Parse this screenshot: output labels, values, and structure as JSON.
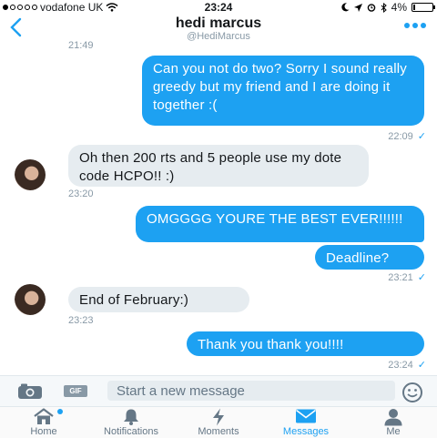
{
  "status": {
    "carrier": "vodafone UK",
    "time": "23:24",
    "battery": "4%"
  },
  "header": {
    "name": "hedi marcus",
    "handle": "@HediMarcus"
  },
  "conversation": {
    "prev_timestamp": "21:49",
    "messages": [
      {
        "dir": "out",
        "text": "Can you not do two? Sorry I sound really greedy but my friend and I are doing it together :("
      },
      {
        "dir": "meta",
        "time": "22:09",
        "check": "✓"
      },
      {
        "dir": "in",
        "text": "Oh then 200 rts and 5 people use my dote code HCPO!! :)"
      },
      {
        "dir": "meta",
        "time": "23:20"
      },
      {
        "dir": "out",
        "text": "OMGGGG YOURE THE BEST EVER!!!!!!"
      },
      {
        "dir": "out",
        "text": "Deadline?"
      },
      {
        "dir": "meta",
        "time": "23:21",
        "check": "✓"
      },
      {
        "dir": "in",
        "text": "End of February:)"
      },
      {
        "dir": "meta",
        "time": "23:23"
      },
      {
        "dir": "out",
        "text": "Thank you thank you!!!!"
      },
      {
        "dir": "meta",
        "time": "23:24",
        "check": "✓"
      }
    ]
  },
  "composer": {
    "gif_label": "GIF",
    "placeholder": "Start a new message"
  },
  "tabs": [
    {
      "label": "Home",
      "icon": "home-icon"
    },
    {
      "label": "Notifications",
      "icon": "bell-icon"
    },
    {
      "label": "Moments",
      "icon": "lightning-icon"
    },
    {
      "label": "Messages",
      "icon": "envelope-icon",
      "active": true
    },
    {
      "label": "Me",
      "icon": "person-icon"
    }
  ],
  "colors": {
    "accent": "#1da1f2",
    "incoming_bubble": "#e6ecf0",
    "meta_text": "#8899a6"
  }
}
